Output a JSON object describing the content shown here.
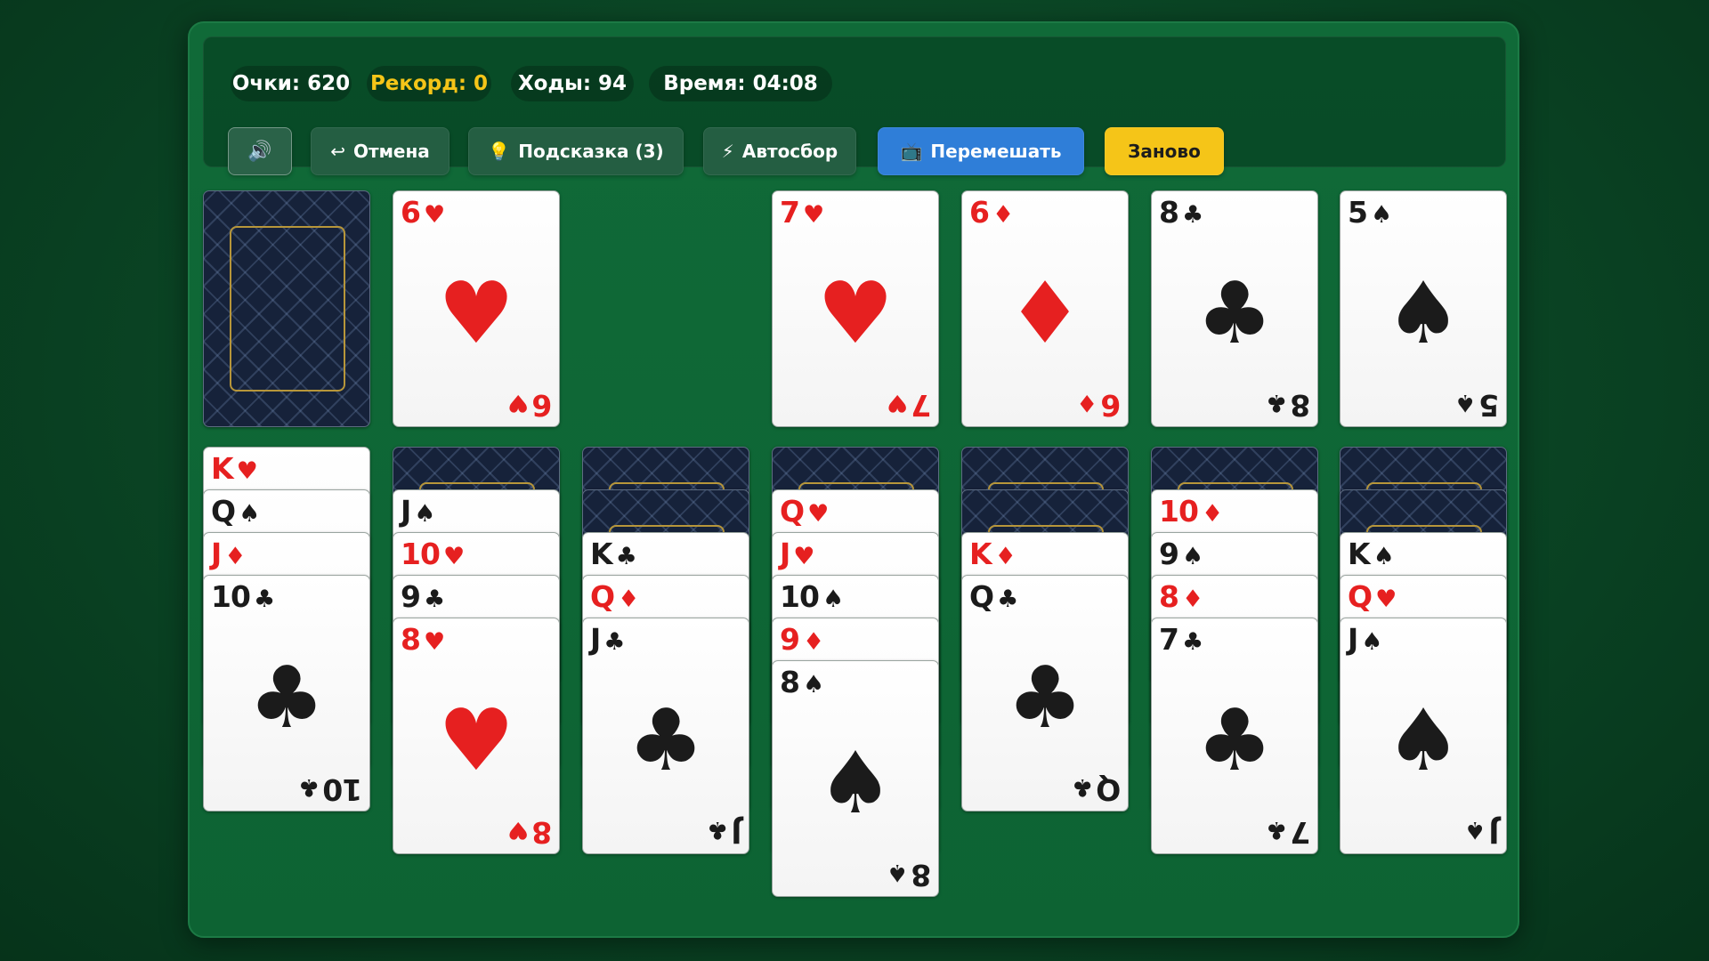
{
  "stats": {
    "score_label": "Очки: 620",
    "record_label": "Рекорд: 0",
    "moves_label": "Ходы: 94",
    "time_label": "Время: 04:08"
  },
  "buttons": {
    "sound_icon": "🔊",
    "undo_icon": "↩",
    "undo_label": "Отмена",
    "hint_icon": "💡",
    "hint_label": "Подсказка (3)",
    "auto_icon": "⚡",
    "auto_label": "Автосбор",
    "shuffle_icon": "📺",
    "shuffle_label": "Перемешать",
    "restart_label": "Заново"
  },
  "colors": {
    "felt": "#0d6333",
    "record": "#f5c518",
    "shuffle_button": "#2f7ed8",
    "restart_button": "#f5c518",
    "red_suit": "#e62020",
    "black_suit": "#1b1b1b"
  },
  "stock": {
    "face_down_count": 1
  },
  "waste": [
    {
      "rank": "6",
      "suit": "♥",
      "color": "red"
    }
  ],
  "foundations": [
    {
      "rank": "7",
      "suit": "♥",
      "color": "red"
    },
    {
      "rank": "6",
      "suit": "♦",
      "color": "red"
    },
    {
      "rank": "8",
      "suit": "♣",
      "color": "black"
    },
    {
      "rank": "5",
      "suit": "♠",
      "color": "black"
    }
  ],
  "tableau": [
    {
      "face_down": 0,
      "cards": [
        {
          "rank": "K",
          "suit": "♥",
          "color": "red"
        },
        {
          "rank": "Q",
          "suit": "♠",
          "color": "black"
        },
        {
          "rank": "J",
          "suit": "♦",
          "color": "red"
        },
        {
          "rank": "10",
          "suit": "♣",
          "color": "black"
        }
      ]
    },
    {
      "face_down": 1,
      "cards": [
        {
          "rank": "J",
          "suit": "♠",
          "color": "black"
        },
        {
          "rank": "10",
          "suit": "♥",
          "color": "red"
        },
        {
          "rank": "9",
          "suit": "♣",
          "color": "black"
        },
        {
          "rank": "8",
          "suit": "♥",
          "color": "red"
        }
      ]
    },
    {
      "face_down": 2,
      "cards": [
        {
          "rank": "K",
          "suit": "♣",
          "color": "black"
        },
        {
          "rank": "Q",
          "suit": "♦",
          "color": "red"
        },
        {
          "rank": "J",
          "suit": "♣",
          "color": "black"
        }
      ]
    },
    {
      "face_down": 1,
      "cards": [
        {
          "rank": "Q",
          "suit": "♥",
          "color": "red"
        },
        {
          "rank": "J",
          "suit": "♥",
          "color": "red"
        },
        {
          "rank": "10",
          "suit": "♠",
          "color": "black"
        },
        {
          "rank": "9",
          "suit": "♦",
          "color": "red"
        },
        {
          "rank": "8",
          "suit": "♠",
          "color": "black"
        }
      ]
    },
    {
      "face_down": 2,
      "cards": [
        {
          "rank": "K",
          "suit": "♦",
          "color": "red"
        },
        {
          "rank": "Q",
          "suit": "♣",
          "color": "black"
        }
      ]
    },
    {
      "face_down": 1,
      "cards": [
        {
          "rank": "10",
          "suit": "♦",
          "color": "red"
        },
        {
          "rank": "9",
          "suit": "♠",
          "color": "black"
        },
        {
          "rank": "8",
          "suit": "♦",
          "color": "red"
        },
        {
          "rank": "7",
          "suit": "♣",
          "color": "black"
        }
      ]
    },
    {
      "face_down": 2,
      "cards": [
        {
          "rank": "K",
          "suit": "♠",
          "color": "black"
        },
        {
          "rank": "Q",
          "suit": "♥",
          "color": "red"
        },
        {
          "rank": "J",
          "suit": "♠",
          "color": "black"
        }
      ]
    }
  ]
}
